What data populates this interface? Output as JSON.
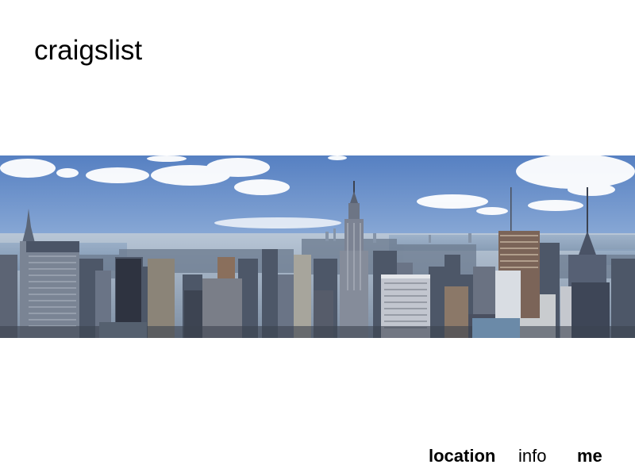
{
  "site": {
    "logo_text": "craigslist"
  },
  "hero": {
    "image": "new-york-city-skyline-panorama",
    "sky_color_top": "#5d86c7",
    "sky_color_bottom": "#c9d8ea"
  },
  "nav": {
    "location_label": "location",
    "info_label": "info",
    "me_label": "me"
  }
}
